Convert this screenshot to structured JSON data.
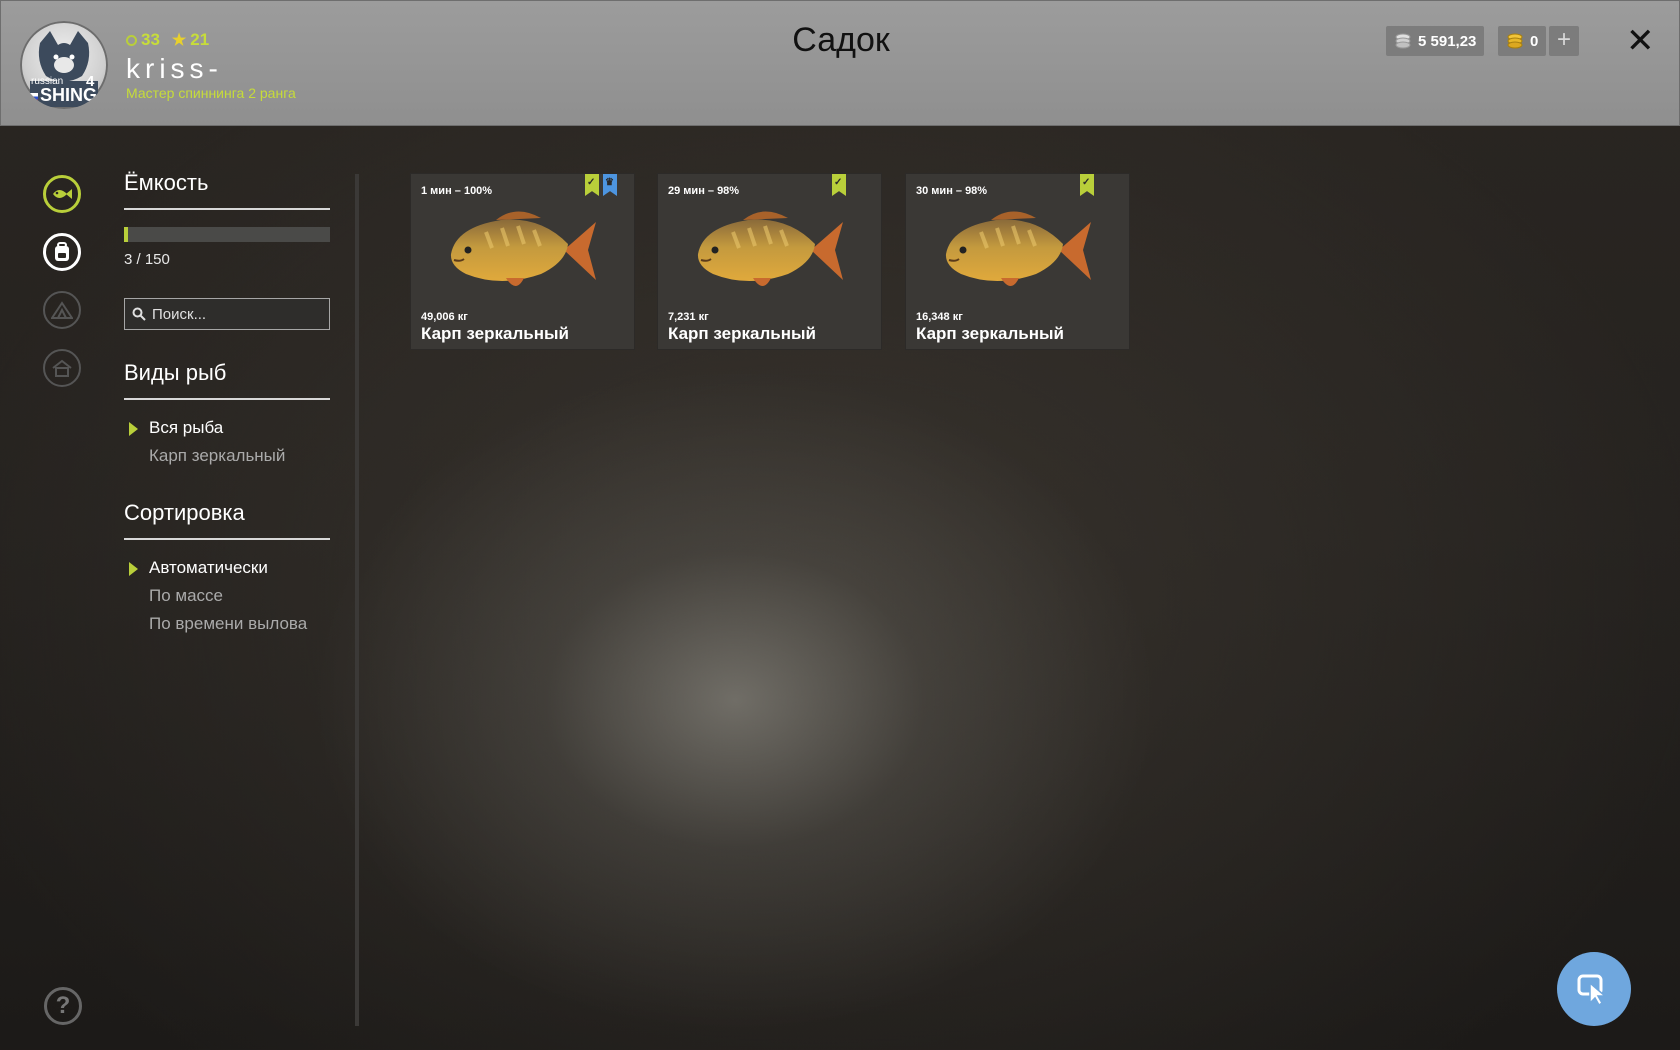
{
  "header": {
    "logo_text_top": "russian",
    "logo_text_bottom": "SHING",
    "logo_number": "4",
    "level": "33",
    "stars": "21",
    "username": "kriss-",
    "rank": "Мастер спиннинга 2 ранга",
    "title": "Садок",
    "silver": "5 591,23",
    "gold": "0",
    "plus_label": "+",
    "close_label": "✕"
  },
  "nav": {
    "icons": [
      "fish-icon",
      "backpack-icon",
      "tent-icon",
      "house-icon"
    ]
  },
  "capacity": {
    "title": "Ёмкость",
    "current": 3,
    "max": 150,
    "text": "3 / 150"
  },
  "search": {
    "placeholder": "Поиск..."
  },
  "species": {
    "title": "Виды рыб",
    "items": [
      {
        "label": "Вся рыба",
        "active": true
      },
      {
        "label": "Карп зеркальный",
        "active": false
      }
    ]
  },
  "sorting": {
    "title": "Сортировка",
    "items": [
      {
        "label": "Автоматически",
        "active": true
      },
      {
        "label": "По массе",
        "active": false
      },
      {
        "label": "По времени вылова",
        "active": false
      }
    ]
  },
  "fish_cards": [
    {
      "time": "1 мин – 100%",
      "weight": "49,006 кг",
      "name": "Карп зеркальный",
      "badges": [
        "check",
        "crown"
      ]
    },
    {
      "time": "29 мин – 98%",
      "weight": "7,231 кг",
      "name": "Карп зеркальный",
      "badges": [
        "check"
      ]
    },
    {
      "time": "30 мин – 98%",
      "weight": "16,348 кг",
      "name": "Карп зеркальный",
      "badges": [
        "check"
      ]
    }
  ],
  "help_label": "?",
  "colors": {
    "accent": "#b9cf3a",
    "blue_badge": "#4d95e0",
    "cursor_button": "#6fa7de"
  }
}
